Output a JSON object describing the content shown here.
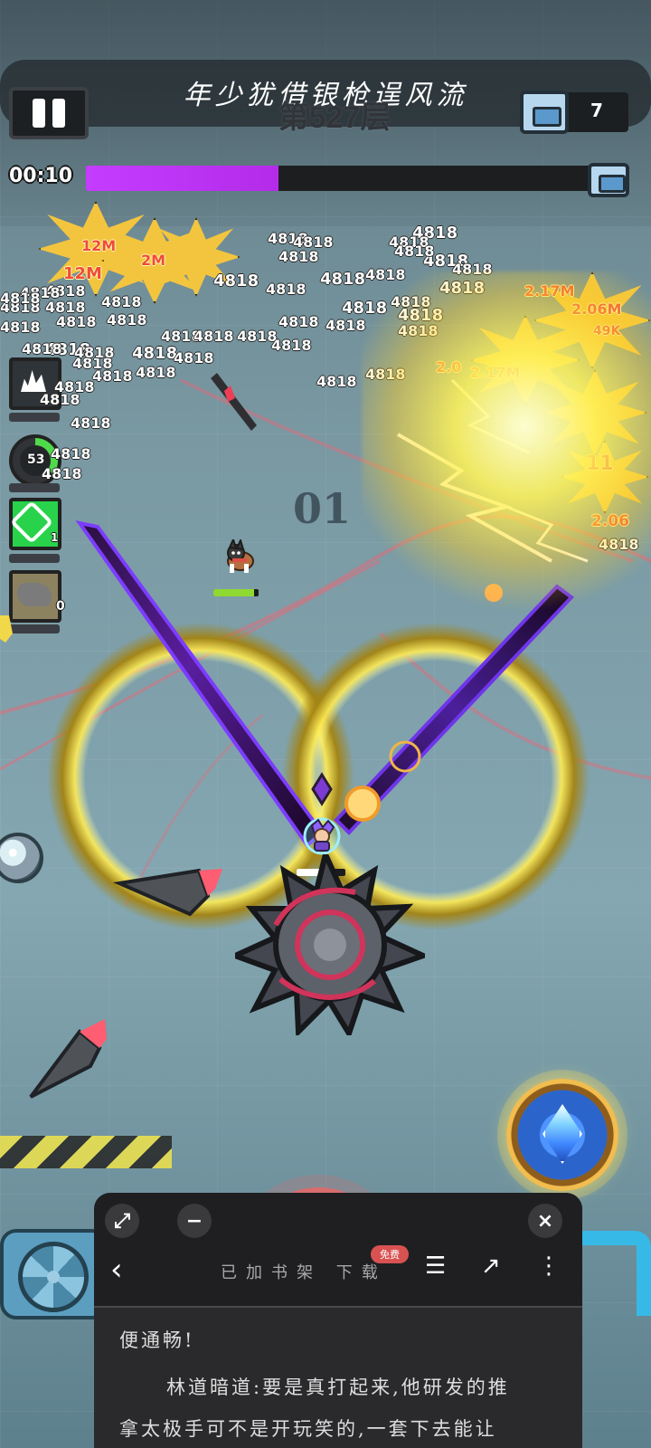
{
  "hud": {
    "novel_title": "年少犹借银枪逞风流",
    "floor_label": "第527层",
    "chest_count": "7",
    "timer": "00:10",
    "progress_percent": 38
  },
  "skills": {
    "cooldown_value": "53",
    "green_count": "1",
    "brown_count": "0"
  },
  "field": {
    "sign_text": "01",
    "damage_numbers": [
      "4818",
      "4818",
      "4818",
      "4818",
      "4818",
      "4818",
      "4818",
      "4818",
      "4818",
      "4818",
      "4818",
      "4818",
      "4818",
      "4818",
      "4818",
      "4818",
      "4818",
      "4818",
      "4818",
      "4818",
      "4818",
      "4818",
      "4818",
      "4818",
      "4818",
      "4818",
      "4818",
      "4818",
      "4818",
      "4818",
      "4818",
      "4818",
      "4818",
      "4818",
      "4818",
      "4818",
      "4818",
      "4818",
      "4818",
      "4818",
      "4818",
      "4818",
      "4818",
      "4818",
      "4818",
      "4818",
      "4818",
      "4818"
    ],
    "big_hits": [
      "12M",
      "12M",
      "2M",
      "2.17M",
      "2.06M",
      "2.06",
      "2.17M",
      "49K",
      "2.0",
      "11"
    ]
  },
  "reader": {
    "status_text": "已加书架   下载",
    "badge_text": "免费",
    "text_line_1": "便通畅!",
    "text_line_2": "林道暗道:要是真打起来,他研发的推",
    "text_line_3": "拿太极手可不是开玩笑的,一套下去能让"
  },
  "icons": {
    "pause": "pause-icon",
    "chest": "treasure-chest-icon",
    "close": "close-icon",
    "minimize": "minimize-icon",
    "expand": "expand-icon",
    "back": "back-icon",
    "chat": "chat-icon",
    "share": "share-icon",
    "more": "more-icon",
    "bookmark": "bookmark-icon"
  },
  "colors": {
    "progress_fill": "#c43cff",
    "damage_red": "#ef4b3b",
    "hit_yellow": "#f3c53e",
    "reader_bg": "#2a2a2c",
    "reader_button": "#e45d5b"
  }
}
